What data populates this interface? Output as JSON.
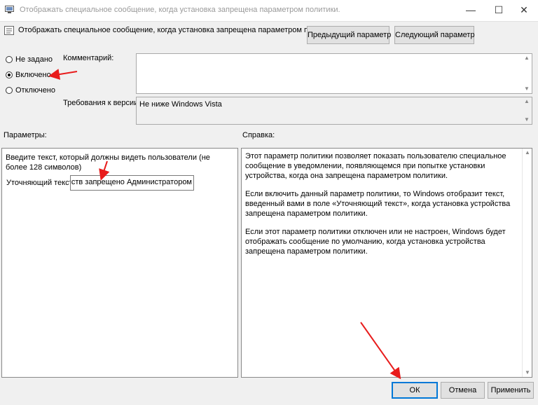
{
  "window": {
    "title": "Отображать специальное сообщение, когда установка запрещена параметром политики.",
    "minimize_glyph": "—",
    "maximize_glyph": "☐",
    "close_glyph": "✕"
  },
  "header": {
    "policy_name": "Отображать специальное сообщение, когда установка запрещена параметром политики.",
    "prev_button": "Предыдущий параметр",
    "next_button": "Следующий параметр"
  },
  "state": {
    "options": [
      {
        "label": "Не задано",
        "selected": false
      },
      {
        "label": "Включено",
        "selected": true
      },
      {
        "label": "Отключено",
        "selected": false
      }
    ]
  },
  "comment": {
    "label": "Комментарий:",
    "value": ""
  },
  "version": {
    "label": "Требования к версии:",
    "value": "Не ниже Windows Vista"
  },
  "params": {
    "header": "Параметры:",
    "description": "Введите текст, который должны видеть пользователи (не более 128 символов)",
    "field_label": "Уточняющий текст",
    "field_value": "тройств запрещено Администратором"
  },
  "help": {
    "header": "Справка:",
    "paragraphs": [
      "Этот параметр политики позволяет показать пользователю специальное сообщение в уведомлении, появляющемся при попытке установки устройства, когда она запрещена параметром политики.",
      "Если включить данный параметр политики, то Windows отобразит текст, введенный вами в поле «Уточняющий текст», когда установка устройства запрещена параметром политики.",
      "Если этот параметр политики отключен или не настроен, Windows будет отображать сообщение по умолчанию, когда установка устройства запрещена параметром политики."
    ]
  },
  "footer": {
    "ok": "ОК",
    "cancel": "Отмена",
    "apply": "Применить"
  },
  "colors": {
    "annotation_arrow": "#e81c1c",
    "window_bg": "#f0f0f0"
  }
}
